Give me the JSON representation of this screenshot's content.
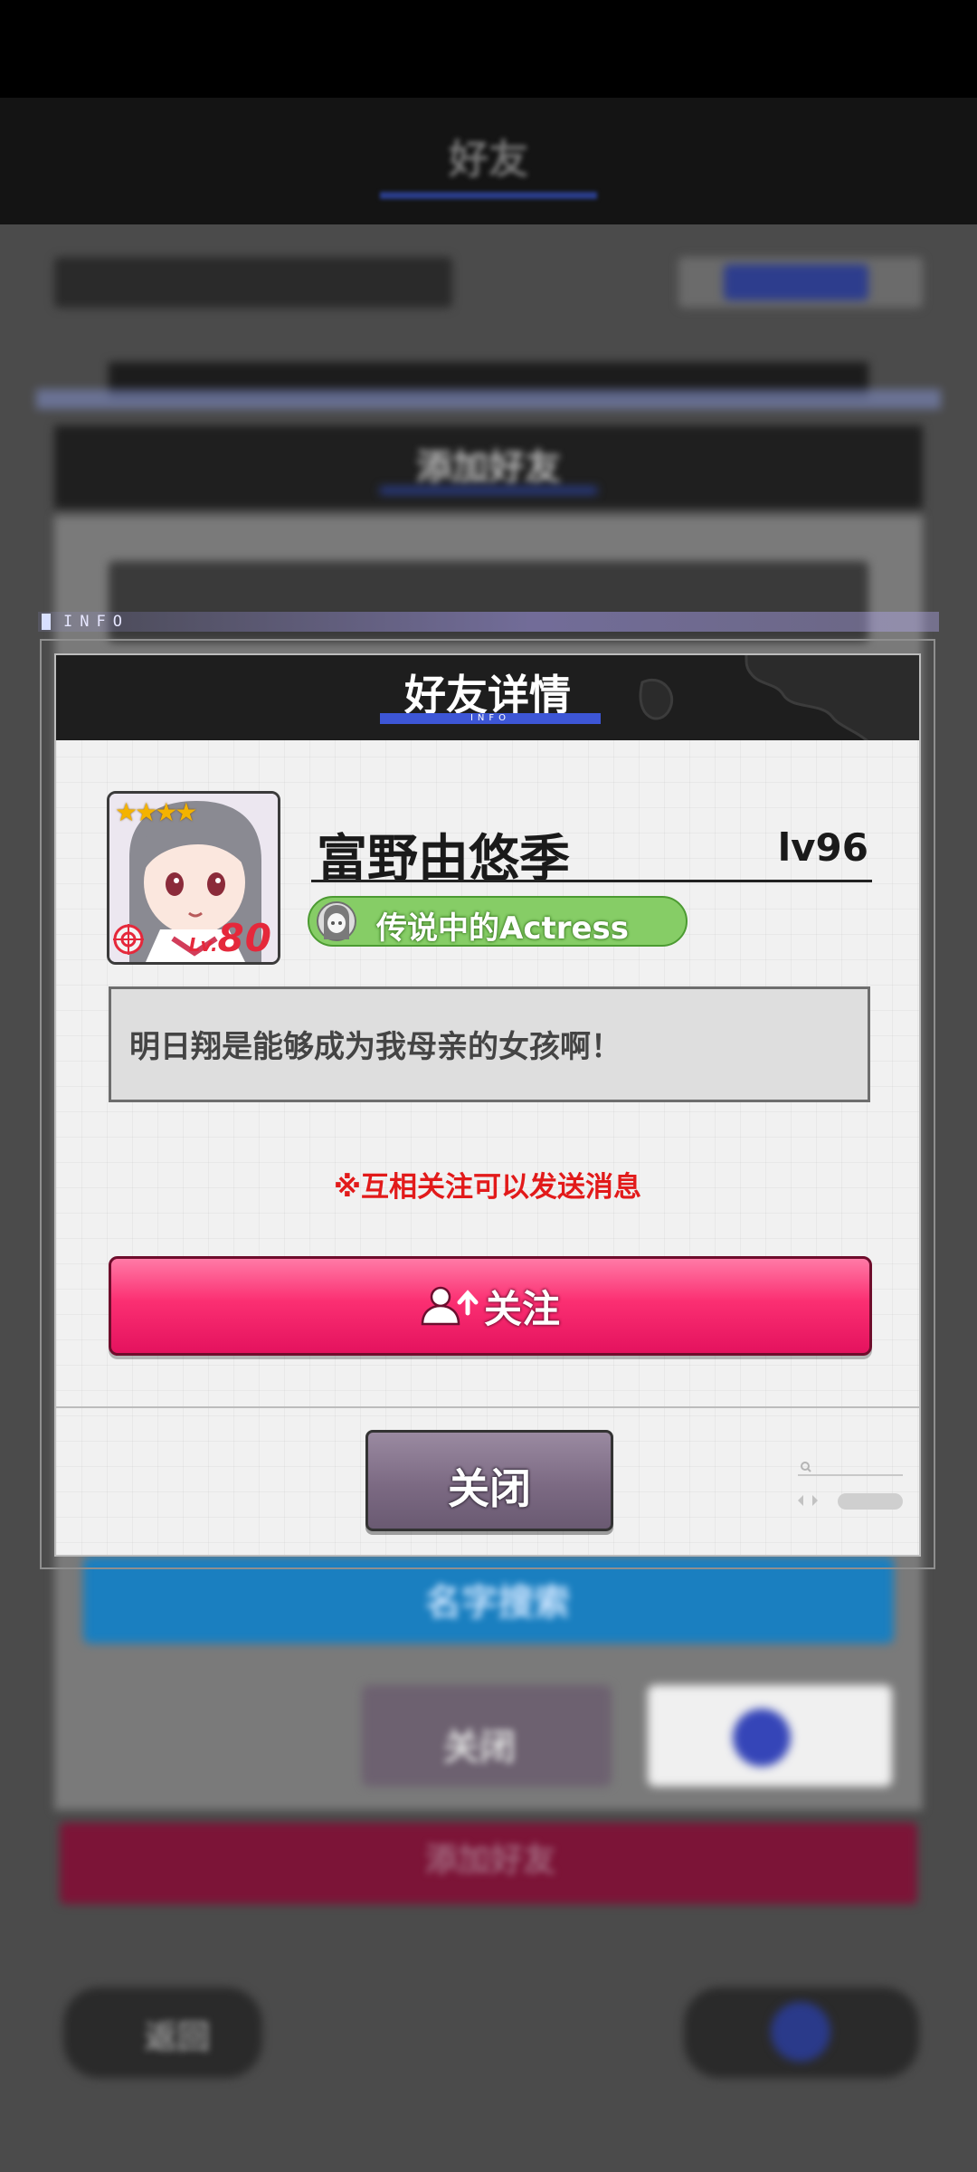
{
  "background_screen": {
    "header_title": "好友",
    "section_title": "添加好友",
    "search_button": "名字搜索",
    "cancel_button": "关闭",
    "bottom_button": "添加好友",
    "left_footer_button": "返回"
  },
  "info_strip": {
    "label": "INFO"
  },
  "dialog": {
    "title": "好友详情",
    "title_sub": "INFO",
    "player": {
      "name": "富野由悠季",
      "level": "lv96",
      "stars": "★★★★",
      "card_level_prefix": "Lv.",
      "card_level": "80",
      "title_badge": "传说中的Actress",
      "bio": "明日翔是能够成为我母亲的女孩啊！"
    },
    "notice": "※互相关注可以发送消息",
    "follow_button": "关注",
    "close_button": "关闭"
  },
  "colors": {
    "follow_button": "#fb2f72",
    "close_button": "#7c6a83",
    "title_badge": "#86cd66",
    "notice": "#e21a1a",
    "header_bar": "#3d56d6"
  }
}
